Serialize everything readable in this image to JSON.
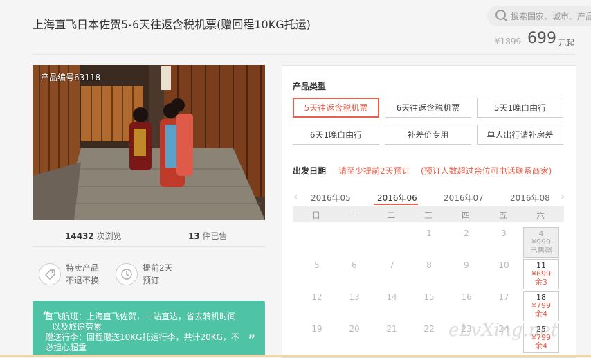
{
  "product": {
    "title": "上海直飞日本佐贺5-6天往返含税机票(赠回程10KG托运)",
    "old_price": "¥1899",
    "price": "699",
    "price_suffix": "元起",
    "product_no": "产品编号63118"
  },
  "search": {
    "placeholder": "搜索国家、城市、产品"
  },
  "stats": {
    "views": "14432",
    "views_label": "次浏览",
    "sold": "13",
    "sold_label": "件已售"
  },
  "badges": [
    {
      "icon": "tag-icon",
      "line1": "特卖产品",
      "line2": "不退不换"
    },
    {
      "icon": "clock-icon",
      "line1": "提前2天",
      "line2": "预订"
    }
  ],
  "note": {
    "line1": "直飞航班：上海直飞佐贺，一站直达，省去转机时间",
    "line2": "以及旅途劳累",
    "line3": "赠送行李：回程赠送10KG托运行李，共计20KG，不",
    "line4": "必担心超重"
  },
  "product_type": {
    "title": "产品类型",
    "options": [
      "5天往返含税机票",
      "6天往返含税机票",
      "5天1晚自由行",
      "6天1晚自由行",
      "补差价专用",
      "单人出行请补房差"
    ],
    "selected_index": 0
  },
  "departure": {
    "title": "出发日期",
    "hint1": "请至少提前2天预订",
    "hint2": "(预订人数超过余位可电话联系商家)"
  },
  "calendar": {
    "months": [
      "2016年05",
      "2016年06",
      "2016年07",
      "2016年08"
    ],
    "selected_month_index": 1,
    "weekdays": [
      "日",
      "一",
      "二",
      "三",
      "四",
      "五",
      "六"
    ],
    "rows": [
      [
        "",
        "",
        "",
        "1",
        "2",
        "3",
        "4"
      ],
      [
        "5",
        "6",
        "7",
        "8",
        "9",
        "10",
        "11"
      ],
      [
        "12",
        "13",
        "14",
        "15",
        "16",
        "17",
        "18"
      ],
      [
        "19",
        "20",
        "21",
        "22",
        "23",
        "24",
        "25"
      ]
    ],
    "priced": {
      "4": {
        "price": "¥999",
        "status": "已售罄",
        "soldout": true
      },
      "11": {
        "price": "¥699",
        "status": "余3",
        "soldout": false
      },
      "18": {
        "price": "¥799",
        "status": "余4",
        "soldout": false
      },
      "25": {
        "price": "¥799",
        "status": "余4",
        "soldout": false
      }
    }
  },
  "watermark": "eLvXing.net",
  "colors": {
    "accent": "#e8604c",
    "note_bg": "#4ec3a5"
  }
}
